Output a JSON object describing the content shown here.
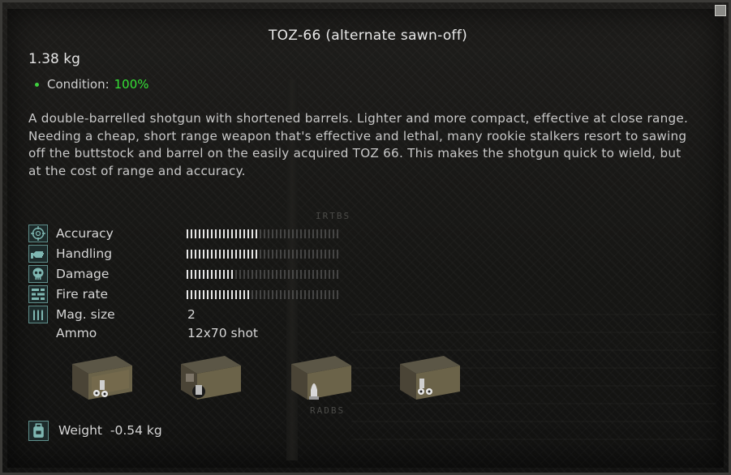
{
  "item": {
    "title": "TOZ-66 (alternate sawn-off)",
    "weight": "1.38 kg",
    "condition_label": "Condition:",
    "condition_value": "100%",
    "description": "A double-barrelled shotgun with shortened barrels. Lighter and more compact, effective at close range. Needing a cheap, short range weapon that's effective and lethal, many rookie stalkers resort to sawing off the buttstock and barrel on the easily acquired TOZ 66. This makes the shotgun quick to wield, but at the cost of range and accuracy."
  },
  "stats": [
    {
      "label": "Accuracy",
      "icon": "crosshair-icon",
      "fill": 0.47
    },
    {
      "label": "Handling",
      "icon": "hand-icon",
      "fill": 0.47
    },
    {
      "label": "Damage",
      "icon": "skull-icon",
      "fill": 0.3
    },
    {
      "label": "Fire rate",
      "icon": "fire-rate-icon",
      "fill": 0.42
    }
  ],
  "mag": {
    "label": "Mag. size",
    "icon": "ammo-icon",
    "value": "2"
  },
  "ammo": {
    "label": "Ammo",
    "value": "12x70 shot",
    "boxes": [
      "buckshot-box-icon",
      "slug-box-icon",
      "dart-box-icon",
      "buckshot-box-icon"
    ]
  },
  "weight_mod": {
    "label": "Weight",
    "value": "-0.54 kg",
    "icon": "backpack-icon"
  },
  "background_stamps": [
    "IRTBS",
    "RADBS"
  ],
  "colors": {
    "condition_good": "#35e135",
    "icon_border": "#5f8f8c"
  }
}
